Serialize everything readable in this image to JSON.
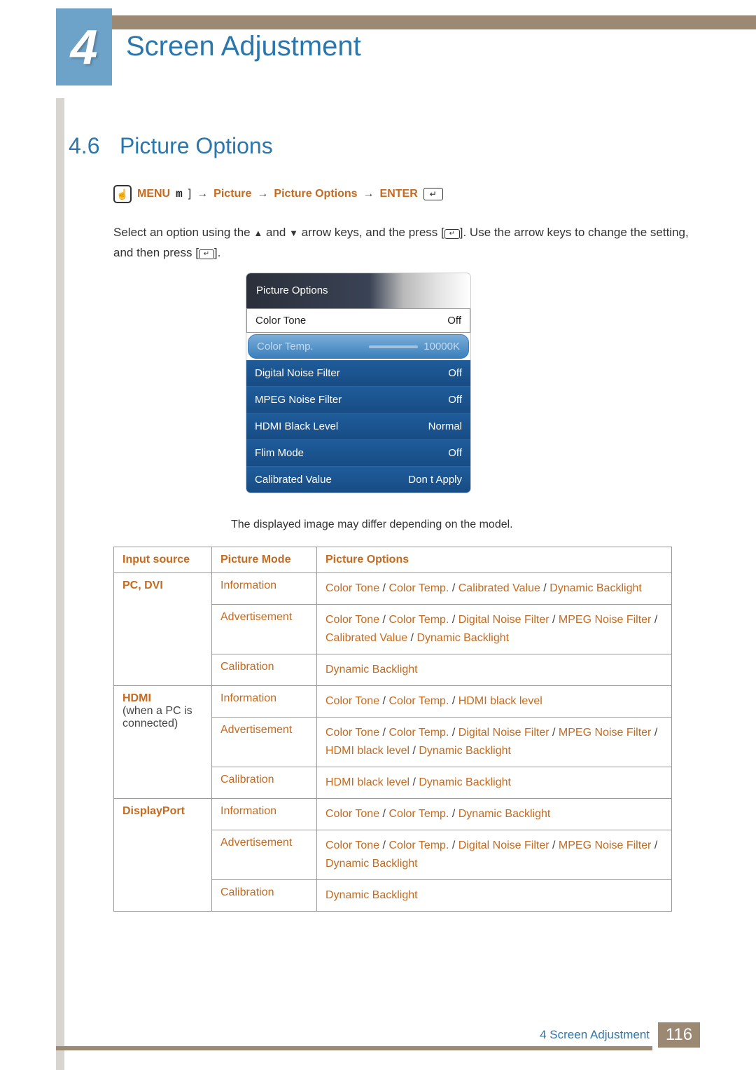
{
  "chapter": {
    "number": "4",
    "title": "Screen Adjustment"
  },
  "section": {
    "number": "4.6",
    "title": "Picture Options"
  },
  "nav": {
    "menu": "MENU",
    "m": "m",
    "arrow": "→",
    "crumb1": "Picture",
    "crumb2": "Picture Options",
    "enter": "ENTER"
  },
  "description": {
    "part1": "Select an option using the ",
    "up": "▲",
    "and": " and ",
    "down": "▼",
    "part2": " arrow keys, and the press [",
    "part3": "]. Use the arrow keys to change the setting, and then press [",
    "part4": "].",
    "enter_glyph": "↵"
  },
  "osd": {
    "title": "Picture Options",
    "rows": [
      {
        "label": "Color Tone",
        "value": "Off",
        "style": "white"
      },
      {
        "label": "Color Temp.",
        "value": "10000K",
        "style": "highlight",
        "slider": true
      },
      {
        "label": "Digital Noise Filter",
        "value": "Off",
        "style": "blue"
      },
      {
        "label": "MPEG Noise Filter",
        "value": "Off",
        "style": "blue"
      },
      {
        "label": "HDMI Black Level",
        "value": "Normal",
        "style": "blue"
      },
      {
        "label": "Flim Mode",
        "value": "Off",
        "style": "blue"
      },
      {
        "label": "Calibrated Value",
        "value": "Don t Apply",
        "style": "blue"
      }
    ]
  },
  "caption": "The displayed image may differ depending on the model.",
  "table": {
    "headers": {
      "src": "Input source",
      "mode": "Picture Mode",
      "opts": "Picture Options"
    },
    "sep": " / ",
    "groups": [
      {
        "src_head": "PC, DVI",
        "src_sub": "",
        "rows": [
          {
            "mode": "Information",
            "opts": [
              "Color Tone",
              "Color Temp.",
              "Calibrated Value",
              "Dynamic Backlight"
            ]
          },
          {
            "mode": "Advertisement",
            "opts": [
              "Color Tone",
              "Color Temp.",
              "Digital Noise Filter",
              "MPEG Noise Filter",
              "Calibrated Value",
              "Dynamic Backlight"
            ]
          },
          {
            "mode": "Calibration",
            "opts": [
              "Dynamic Backlight"
            ]
          }
        ]
      },
      {
        "src_head": "HDMI",
        "src_sub": "(when a PC is connected)",
        "rows": [
          {
            "mode": "Information",
            "opts": [
              "Color Tone",
              "Color Temp.",
              "HDMI black level"
            ]
          },
          {
            "mode": "Advertisement",
            "opts": [
              "Color Tone",
              "Color Temp.",
              "Digital Noise Filter",
              "MPEG Noise Filter",
              "HDMI black level",
              "Dynamic Backlight"
            ]
          },
          {
            "mode": "Calibration",
            "opts": [
              "HDMI black level",
              "Dynamic Backlight"
            ]
          }
        ]
      },
      {
        "src_head": "DisplayPort",
        "src_sub": "",
        "rows": [
          {
            "mode": "Information",
            "opts": [
              "Color Tone",
              "Color Temp.",
              "Dynamic Backlight"
            ]
          },
          {
            "mode": "Advertisement",
            "opts": [
              "Color Tone",
              "Color Temp.",
              "Digital Noise Filter",
              "MPEG Noise Filter",
              "Dynamic Backlight"
            ]
          },
          {
            "mode": "Calibration",
            "opts": [
              "Dynamic Backlight"
            ]
          }
        ]
      }
    ]
  },
  "footer": {
    "chapter_ref": "4 Screen Adjustment",
    "page": "116"
  }
}
